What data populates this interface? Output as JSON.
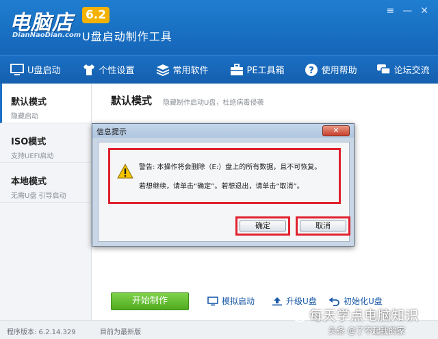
{
  "header": {
    "logo": "电脑店",
    "logo_sub": "DianNaoDian.com",
    "version": "6.2",
    "subtitle": "U盘启动制作工具",
    "win_controls": [
      "≡",
      "—",
      "✕"
    ]
  },
  "nav": {
    "items": [
      {
        "label": "U盘启动",
        "icon": "monitor-icon"
      },
      {
        "label": "个性设置",
        "icon": "shirt-icon"
      },
      {
        "label": "常用软件",
        "icon": "layers-icon"
      },
      {
        "label": "PE工具箱",
        "icon": "toolbox-icon"
      },
      {
        "label": "使用帮助",
        "icon": "question-icon"
      },
      {
        "label": "论坛交流",
        "icon": "chat-icon"
      }
    ]
  },
  "sidebar": {
    "items": [
      {
        "title": "默认模式",
        "desc": "隐藏启动"
      },
      {
        "title": "ISO模式",
        "desc": "支持UEFI启动"
      },
      {
        "title": "本地模式",
        "desc": "无需U盘 引导启动"
      }
    ]
  },
  "main": {
    "title": "默认模式",
    "desc": "隐藏制作启动U盘，杜绝病毒侵袭"
  },
  "dialog": {
    "title": "信息提示",
    "close": "✕",
    "line1": "警告: 本操作将会删除（E:）盘上的所有数据，且不可恢复。",
    "line2": "若想继续，请单击“确定”。若想退出，请单击“取消”。",
    "ok": "确定",
    "cancel": "取消"
  },
  "toolbar": {
    "start": "开始制作",
    "simulate": "模拟启动",
    "upgrade": "升级U盘",
    "init": "初始化U盘"
  },
  "status": {
    "version": "程序版本: 6.2.14.329",
    "text": "目前为最新版"
  },
  "watermark": {
    "title": "每天学点电脑知识",
    "byline": "头条 @了不起我的家"
  },
  "colors": {
    "header_blue": "#1f7ed0",
    "badge": "#f4b100",
    "start_green": "#4fab20",
    "highlight_red": "#e0212e"
  }
}
